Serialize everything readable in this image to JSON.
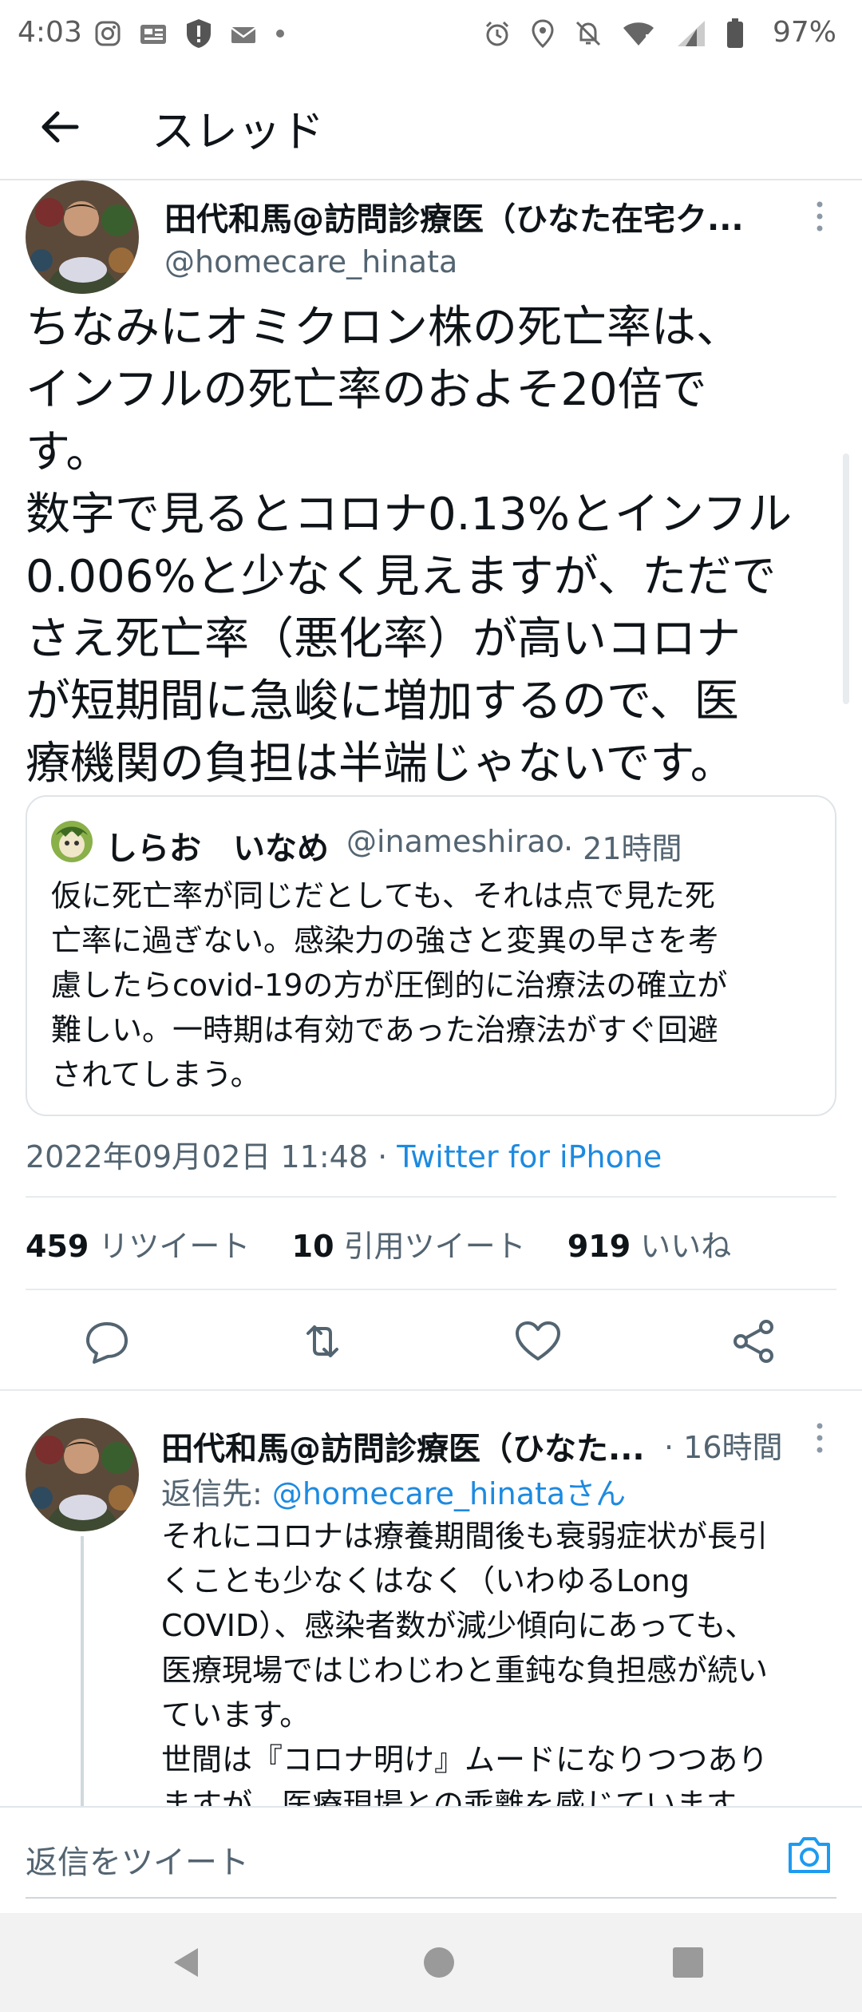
{
  "status_bar": {
    "time": "4:03",
    "battery": "97%",
    "icons_left": [
      "instagram-icon",
      "news-icon",
      "shield-alert-icon",
      "mail-icon",
      "dot-icon"
    ],
    "icons_right": [
      "alarm-icon",
      "location-icon",
      "mute-icon",
      "wifi-icon",
      "signal-icon",
      "battery-icon"
    ]
  },
  "header": {
    "title": "スレッド"
  },
  "main_tweet": {
    "author_name": "田代和馬@訪問診療医（ひなた在宅ク...",
    "author_handle": "@homecare_hinata",
    "text": "ちなみにオミクロン株の死亡率は、\nインフルの死亡率のおよそ20倍で\nす。\n数字で見るとコロナ0.13%とインフル\n0.006%と少なく見えますが、ただで\nさえ死亡率（悪化率）が高いコロナ\nが短期間に急峻に増加するので、医\n療機関の負担は半端じゃないです。",
    "quoted": {
      "name": "しらお　いなめ",
      "handle": "@inameshirao",
      "time": "· 21時間",
      "text": "仮に死亡率が同じだとしても、それは点で見た死\n亡率に過ぎない。感染力の強さと変異の早さを考\n慮したらcovid-19の方が圧倒的に治療法の確立が\n難しい。一時期は有効であった治療法がすぐ回避\nされてしまう。"
    },
    "timestamp": "2022年09月02日 11:48 ·",
    "source": "Twitter for iPhone",
    "stats": [
      {
        "num": "459",
        "label": "リツイート"
      },
      {
        "num": "10",
        "label": "引用ツイート"
      },
      {
        "num": "919",
        "label": "いいね"
      }
    ]
  },
  "reply": {
    "author_name": "田代和馬@訪問診療医（ひなた...",
    "time": "· 16時間",
    "reply_prefix": "返信先: ",
    "reply_handle": "@homecare_hinataさん",
    "text": "それにコロナは療養期間後も衰弱症状が長引\nくことも少なくはなく（いわゆるLong\nCOVID）、感染者数が減少傾向にあっても、\n医療現場ではじわじわと重鈍な負担感が続い\nています。\n世間は『コロナ明け』ムードになりつつあり\nますが、医療現場との乖離を感じています。"
  },
  "composer": {
    "placeholder": "返信をツイート"
  },
  "colors": {
    "accent": "#1d9bf0",
    "text": "#0f1419",
    "secondary": "#536471"
  }
}
